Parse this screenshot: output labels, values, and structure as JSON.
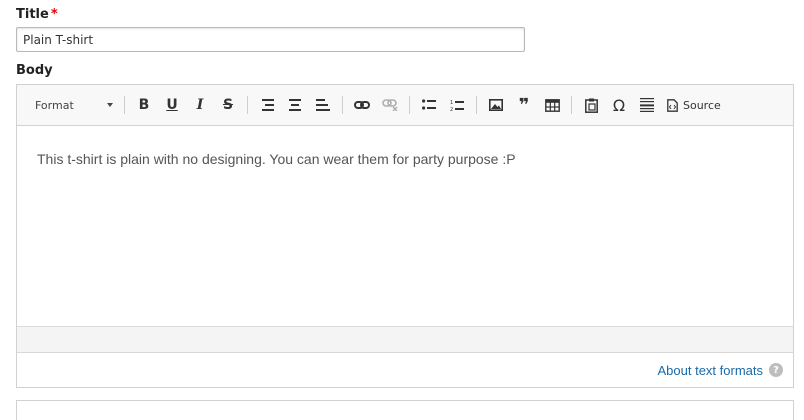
{
  "title_field": {
    "label": "Title",
    "required_mark": "*",
    "value": "Plain T-shirt"
  },
  "body_field": {
    "label": "Body",
    "toolbar": {
      "format_label": "Format",
      "buttons": [
        "bold-icon",
        "underline-icon",
        "italic-icon",
        "strikethrough-icon",
        "align-right-icon",
        "align-center-icon",
        "align-left-icon",
        "link-icon",
        "unlink-icon",
        "bulleted-list-icon",
        "numbered-list-icon",
        "image-icon",
        "blockquote-icon",
        "table-icon",
        "paste-icon",
        "special-character-icon",
        "horizontal-line-icon"
      ],
      "source_label": "Source",
      "quote_glyph": "❞",
      "omega_glyph": "Ω"
    },
    "content": "This t-shirt is plain with no designing. You can wear them for party purpose :P",
    "about_formats_label": "About text formats",
    "help_glyph": "?"
  }
}
